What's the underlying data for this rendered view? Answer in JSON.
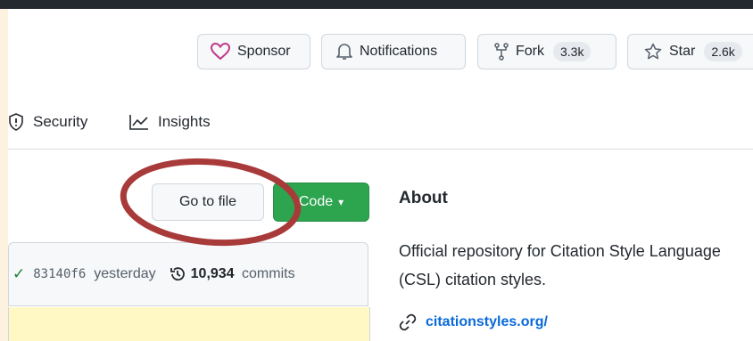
{
  "header": {
    "sponsor_label": "Sponsor",
    "notifications_label": "Notifications",
    "fork_label": "Fork",
    "fork_count": "3.3k",
    "star_label": "Star",
    "star_count": "2.6k"
  },
  "nav": {
    "items": [
      {
        "label": "Security",
        "icon": "shield-icon"
      },
      {
        "label": "Insights",
        "icon": "graph-icon"
      }
    ]
  },
  "toolbar": {
    "go_to_file_label": "Go to file",
    "code_label": "Code"
  },
  "commit": {
    "sha": "83140f6",
    "when": "yesterday",
    "count": "10,934",
    "commits_label": "commits"
  },
  "about": {
    "heading": "About",
    "description": "Official repository for Citation Style Language (CSL) citation styles.",
    "link": "citationstyles.org/"
  },
  "colors": {
    "accent_green": "#2da44e",
    "link_blue": "#0969da",
    "annotation_circle": "#a83a3a",
    "sponsor_heart": "#bf3989"
  }
}
